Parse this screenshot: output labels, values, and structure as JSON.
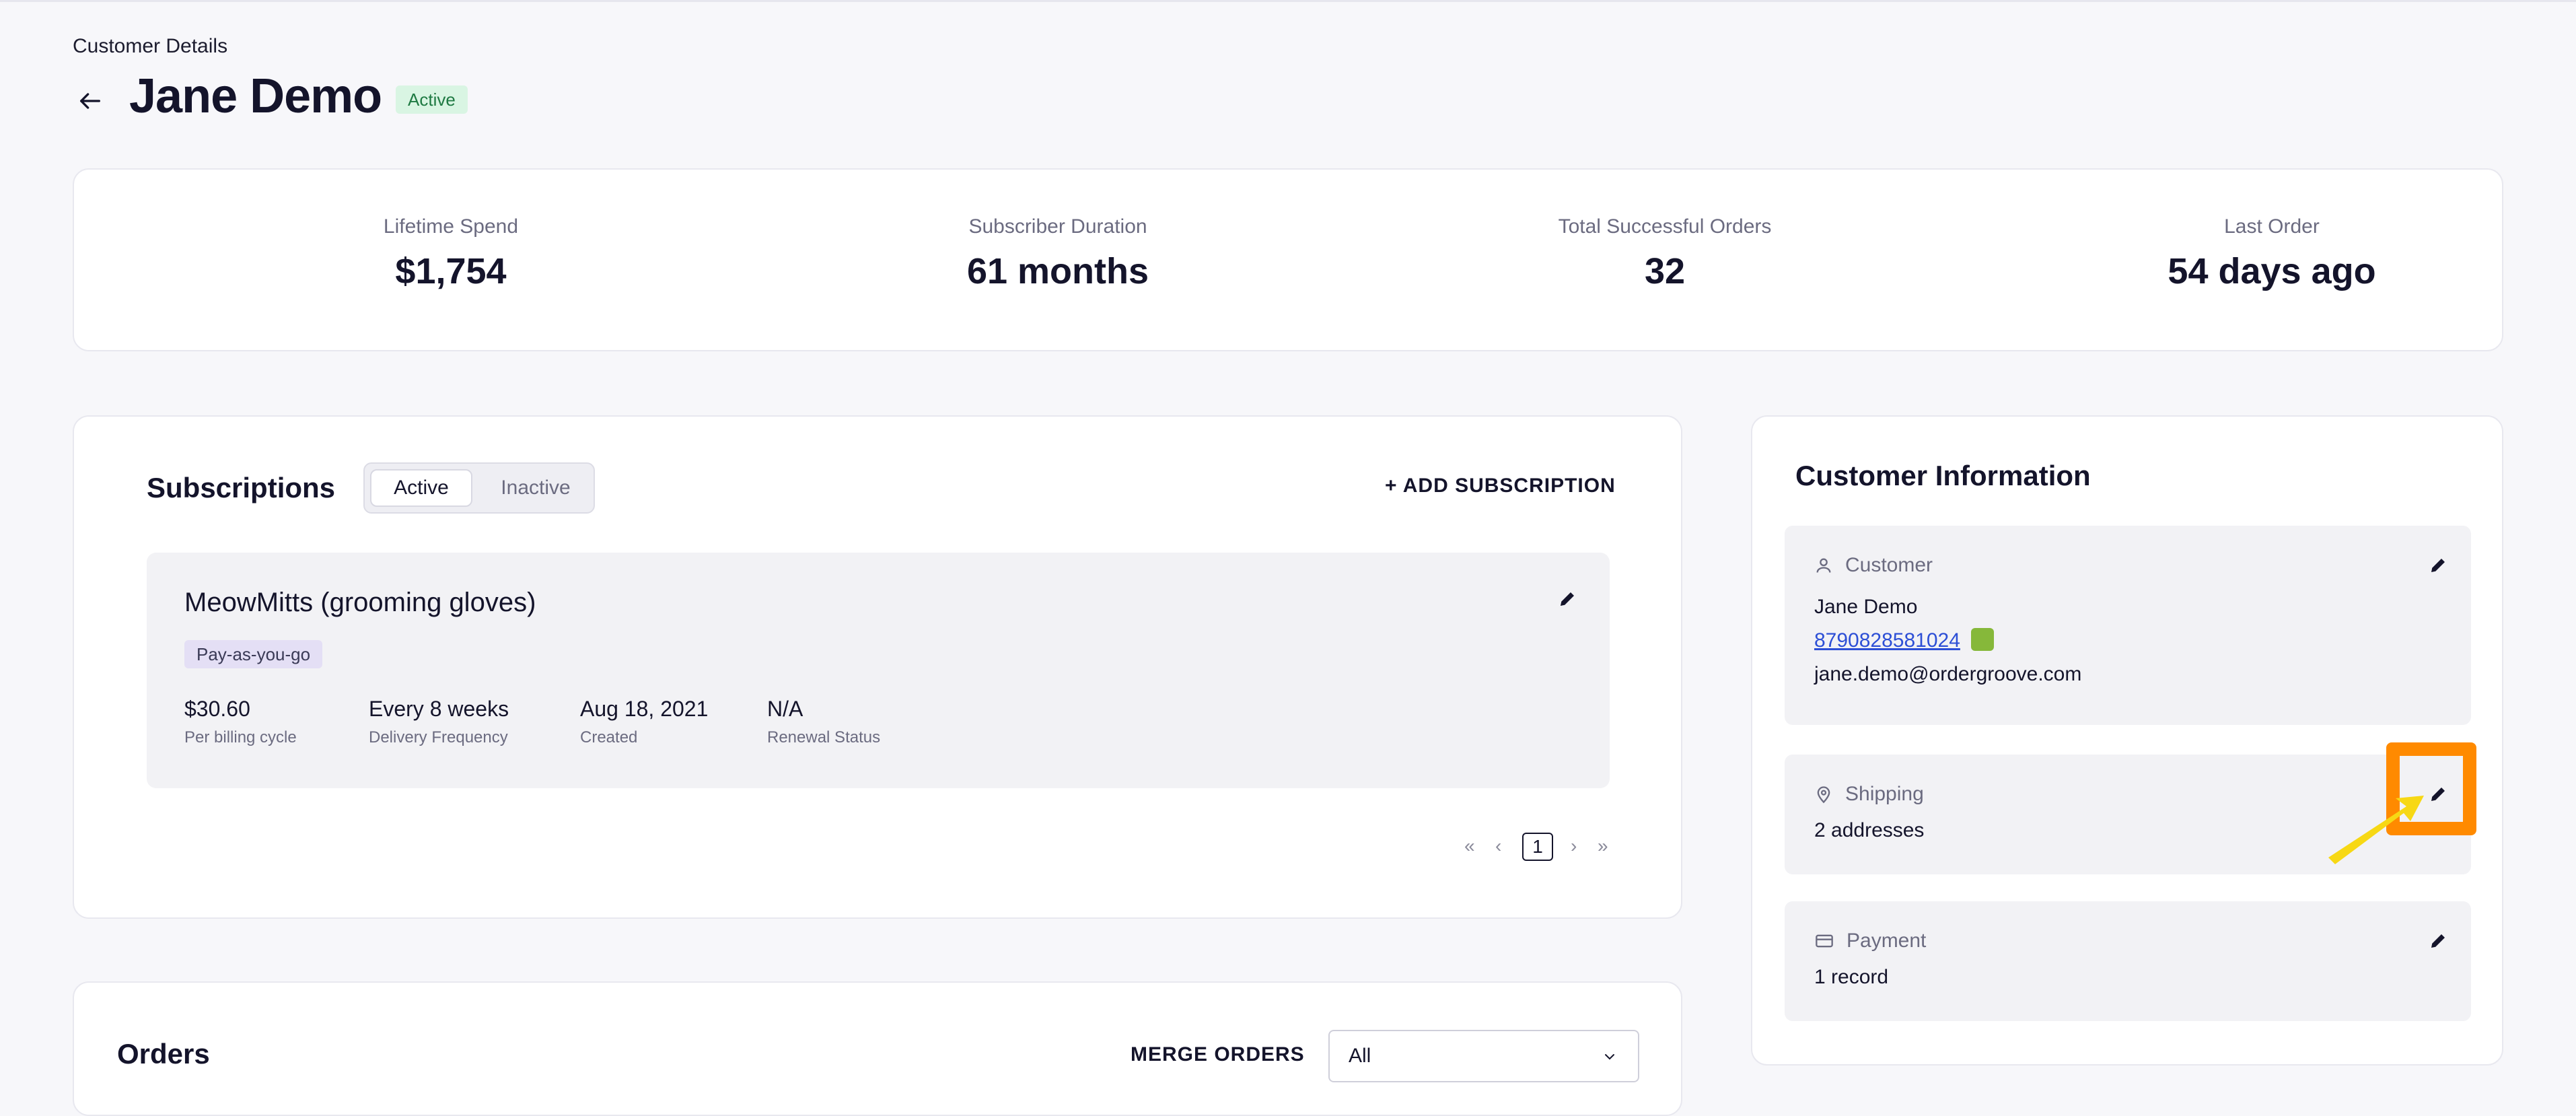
{
  "header": {
    "breadcrumb": "Customer Details",
    "title": "Jane Demo",
    "status": "Active"
  },
  "stats": [
    {
      "label": "Lifetime Spend",
      "value": "$1,754"
    },
    {
      "label": "Subscriber Duration",
      "value": "61 months"
    },
    {
      "label": "Total Successful Orders",
      "value": "32"
    },
    {
      "label": "Last Order",
      "value": "54 days ago"
    }
  ],
  "subscriptions": {
    "title": "Subscriptions",
    "tabs": {
      "active": "Active",
      "inactive": "Inactive"
    },
    "add_label": "+ ADD SUBSCRIPTION",
    "item": {
      "name": "MeowMitts (grooming gloves)",
      "plan": "Pay-as-you-go",
      "metrics": [
        {
          "value": "$30.60",
          "label": "Per billing cycle"
        },
        {
          "value": "Every 8 weeks",
          "label": "Delivery Frequency"
        },
        {
          "value": "Aug 18, 2021",
          "label": "Created"
        },
        {
          "value": "N/A",
          "label": "Renewal Status"
        }
      ]
    },
    "pagination": {
      "first": "«",
      "prev": "‹",
      "page": "1",
      "next": "›",
      "last": "»"
    }
  },
  "orders": {
    "title": "Orders",
    "merge_label": "MERGE ORDERS",
    "filter_value": "All"
  },
  "customer_info": {
    "title": "Customer Information",
    "customer": {
      "label": "Customer",
      "name": "Jane Demo",
      "phone": "8790828581024",
      "email": "jane.demo@ordergroove.com"
    },
    "shipping": {
      "label": "Shipping",
      "summary": "2 addresses"
    },
    "payment": {
      "label": "Payment",
      "summary": "1 record"
    }
  },
  "colors": {
    "background": "#f7f7fa",
    "active_badge": "#d9f5e3",
    "plan_badge": "#e4dff5",
    "link": "#2d4fd6",
    "highlight": "#ff8a00",
    "arrow": "#f7d814"
  },
  "icons": [
    "back-arrow-icon",
    "pencil-icon",
    "user-icon",
    "map-pin-icon",
    "credit-card-icon",
    "shopify-icon",
    "chevron-down-icon"
  ]
}
